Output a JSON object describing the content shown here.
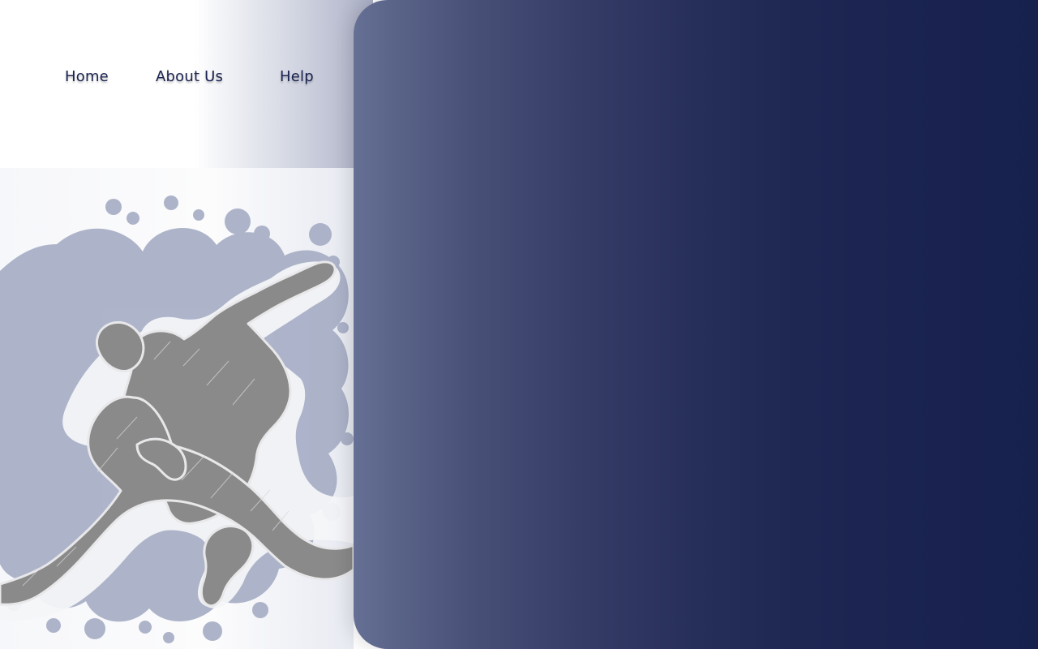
{
  "nav": {
    "items": [
      {
        "label": "Home"
      },
      {
        "label": "About Us"
      },
      {
        "label": "Help"
      }
    ]
  },
  "theme": {
    "nav_text_color": "#1a2350",
    "hero_gradient_start": "#667095",
    "hero_gradient_end": "#17214e",
    "splash_color": "#a7aec5",
    "figure_color": "#8b8b8b"
  },
  "illustration": {
    "icon": "judo-throw-illustration"
  }
}
